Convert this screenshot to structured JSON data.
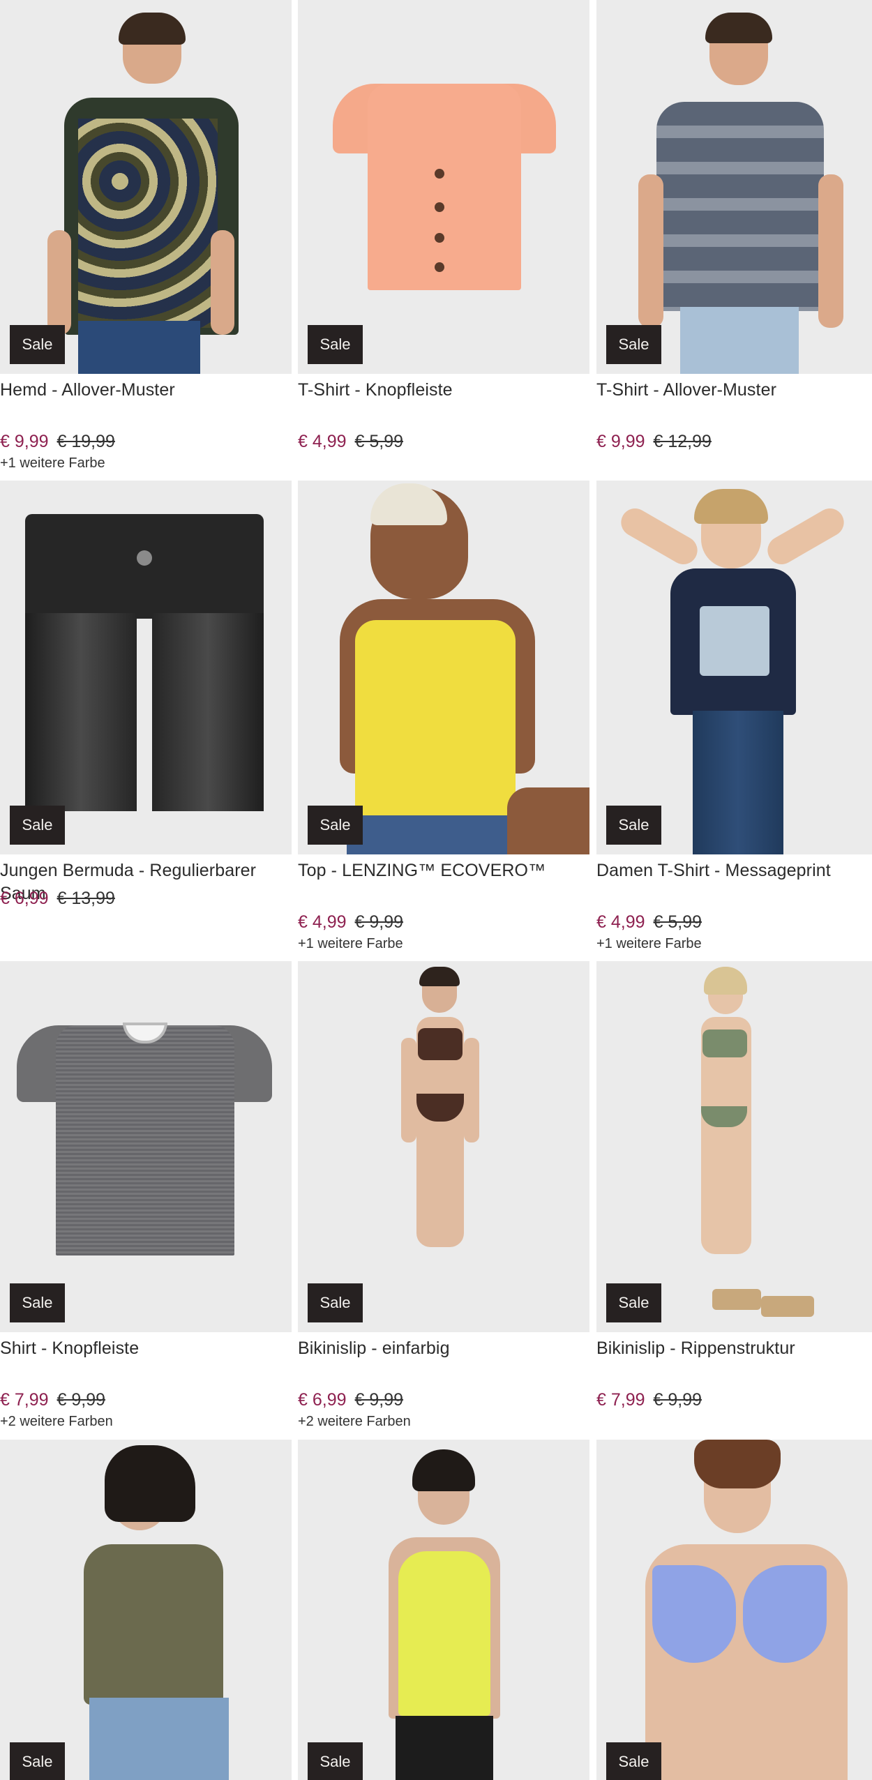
{
  "badge": "Sale",
  "products": [
    {
      "title": "Hemd - Allover-Muster",
      "price": "€ 9,99",
      "old_price": "€ 19,99",
      "colors": "+1 weitere Farbe"
    },
    {
      "title": "T-Shirt - Knopfleiste",
      "price": "€ 4,99",
      "old_price": "€ 5,99",
      "colors": ""
    },
    {
      "title": "T-Shirt - Allover-Muster",
      "price": "€ 9,99",
      "old_price": "€ 12,99",
      "colors": ""
    },
    {
      "title": "Jungen Bermuda - Regulierbarer Saum",
      "price": "€ 6,99",
      "old_price": "€ 13,99",
      "colors": ""
    },
    {
      "title": "Top - LENZING™ ECOVERO™",
      "price": "€ 4,99",
      "old_price": "€ 9,99",
      "colors": "+1 weitere Farbe"
    },
    {
      "title": "Damen T-Shirt - Messageprint",
      "price": "€ 4,99",
      "old_price": "€ 5,99",
      "colors": "+1 weitere Farbe"
    },
    {
      "title": "Shirt - Knopfleiste",
      "price": "€ 7,99",
      "old_price": "€ 9,99",
      "colors": "+2 weitere Farben"
    },
    {
      "title": "Bikinislip - einfarbig",
      "price": "€ 6,99",
      "old_price": "€ 9,99",
      "colors": "+2 weitere Farben"
    },
    {
      "title": "Bikinislip - Rippenstruktur",
      "price": "€ 7,99",
      "old_price": "€ 9,99",
      "colors": ""
    },
    {
      "title": "",
      "price": "",
      "old_price": "",
      "colors": ""
    },
    {
      "title": "",
      "price": "",
      "old_price": "",
      "colors": ""
    },
    {
      "title": "",
      "price": "",
      "old_price": "",
      "colors": ""
    }
  ],
  "colors": {
    "price": "#8e2150",
    "badge_bg": "#262121",
    "badge_text": "#f3f1ee"
  }
}
